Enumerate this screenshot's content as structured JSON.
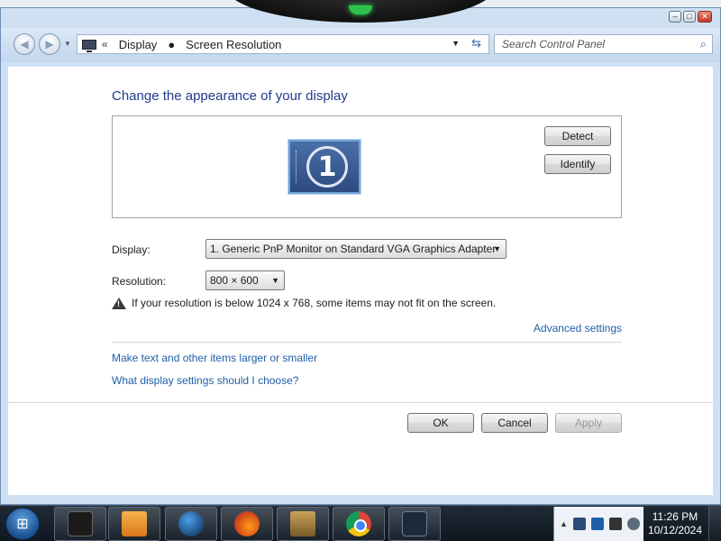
{
  "window": {
    "minimize_glyph": "–",
    "maximize_glyph": "□",
    "close_glyph": "✕"
  },
  "address": {
    "back_glyph": "◀",
    "forward_glyph": "▶",
    "history_glyph": "▼",
    "overflow_glyph": "«",
    "crumbs": [
      "Display",
      "Screen Resolution"
    ],
    "separator_glyph": "●",
    "dropdown_glyph": "▼",
    "refresh_glyph": "⇆",
    "search_placeholder": "Search Control Panel",
    "search_glyph": "⌕"
  },
  "main": {
    "title": "Change the appearance of your display",
    "monitor_number": "1",
    "detect_label": "Detect",
    "identify_label": "Identify",
    "display_label": "Display:",
    "display_value": "1. Generic PnP Monitor on Standard VGA Graphics Adapter",
    "resolution_label": "Resolution:",
    "resolution_value": "800 × 600",
    "combo_arrow": "▼",
    "warning_text": "If your resolution is below 1024 x 768, some items may not fit on the screen.",
    "advanced_link": "Advanced settings",
    "link_text_size": "Make text and other items larger or smaller",
    "link_help": "What display settings should I choose?",
    "ok_label": "OK",
    "cancel_label": "Cancel",
    "apply_label": "Apply"
  },
  "taskbar": {
    "start_glyph": "⊞",
    "tray_expand_glyph": "▲",
    "time": "11:26 PM",
    "date": "10/12/2024"
  },
  "colors": {
    "link": "#1f5fa8",
    "title": "#1e3b8c",
    "window_frame": "#cfe0f2",
    "taskbar": "#0f1720"
  }
}
